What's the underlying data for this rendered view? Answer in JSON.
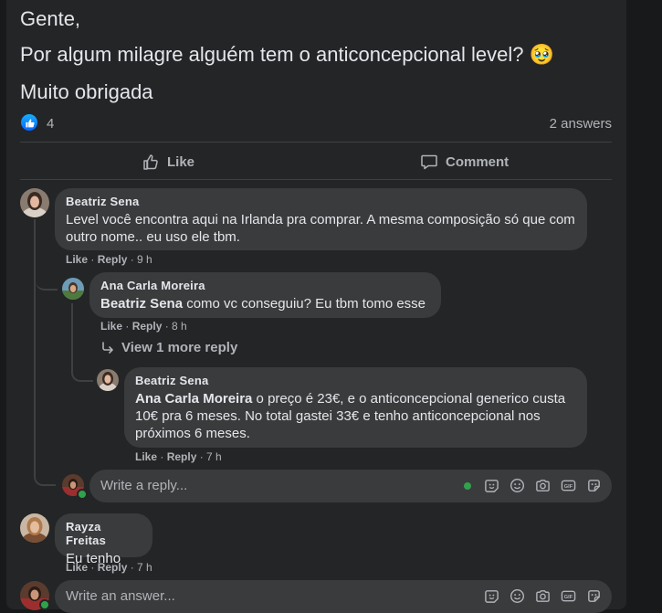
{
  "post": {
    "lines": [
      "Gente,",
      "Por algum milagre alguém tem o anticoncepcional level? 🥹",
      "Muito obrigada"
    ],
    "like_count": "4",
    "answers_count": "2 answers"
  },
  "actions": {
    "like": "Like",
    "comment": "Comment"
  },
  "comments": [
    {
      "author": "Beatriz Sena",
      "text": "Level você encontra aqui na Irlanda pra comprar. A mesma composição só que com outro nome.. eu uso ele tbm.",
      "like": "Like",
      "sep1": " · ",
      "reply": "Reply",
      "time": " · 9 h"
    },
    {
      "author": "Ana Carla Moreira",
      "mention": "Beatriz Sena",
      "text": " como vc conseguiu? Eu tbm tomo esse",
      "like": "Like",
      "sep1": " · ",
      "reply": "Reply",
      "time": " · 8 h"
    },
    {
      "author": "Beatriz Sena",
      "mention": "Ana Carla Moreira",
      "text": " o preço é 23€, e o anticoncepcional generico custa 10€ pra 6 meses. No total gastei 33€ e tenho anticoncepcional nos próximos 6 meses.",
      "like": "Like",
      "sep1": " · ",
      "reply": "Reply",
      "time": " · 7 h"
    },
    {
      "author": "Rayza Freitas",
      "text": "Eu tenho",
      "like": "Like",
      "sep1": " · ",
      "reply": "Reply",
      "time": " · 7 h"
    }
  ],
  "view_more": "View 1 more reply",
  "reply_input": {
    "placeholder": "Write a reply..."
  },
  "answer_input": {
    "placeholder": "Write an answer..."
  },
  "icons": [
    "emoji-icon",
    "camera-icon",
    "gif-icon",
    "sticker-icon",
    "avatar-sticker-icon"
  ],
  "colors": {
    "background": "#18191a",
    "card": "#242526",
    "bubble": "#3a3b3c",
    "accent": "#0866ff",
    "online": "#31a24c"
  }
}
